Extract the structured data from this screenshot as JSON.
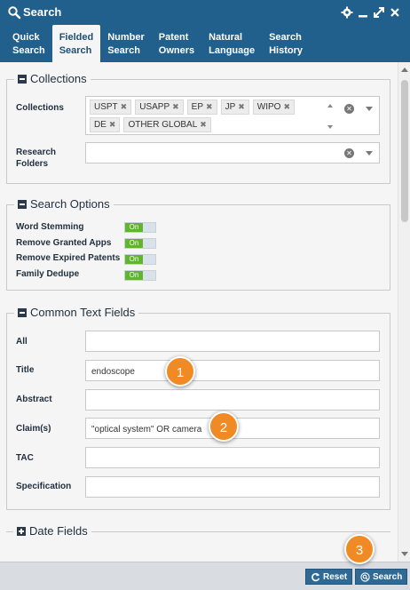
{
  "window": {
    "title": "Search"
  },
  "tabs": [
    {
      "line1": "Quick",
      "line2": "Search"
    },
    {
      "line1": "Fielded",
      "line2": "Search"
    },
    {
      "line1": "Number",
      "line2": "Search"
    },
    {
      "line1": "Patent",
      "line2": "Owners"
    },
    {
      "line1": "Natural",
      "line2": "Language"
    },
    {
      "line1": "Search",
      "line2": "History"
    }
  ],
  "collections": {
    "legend": "Collections",
    "label": "Collections",
    "chips": [
      "USPT",
      "USAPP",
      "EP",
      "JP",
      "WIPO",
      "DE",
      "OTHER GLOBAL"
    ],
    "folders_label_line1": "Research",
    "folders_label_line2": "Folders"
  },
  "options": {
    "legend": "Search Options",
    "items": [
      {
        "label": "Word Stemming",
        "state": "On"
      },
      {
        "label": "Remove Granted Apps",
        "state": "On"
      },
      {
        "label": "Remove Expired Patents",
        "state": "On"
      },
      {
        "label": "Family Dedupe",
        "state": "On"
      }
    ]
  },
  "text_fields": {
    "legend": "Common Text Fields",
    "fields": [
      {
        "label": "All",
        "value": ""
      },
      {
        "label": "Title",
        "value": "endoscope"
      },
      {
        "label": "Abstract",
        "value": ""
      },
      {
        "label": "Claim(s)",
        "value": "\"optical system\" OR camera"
      },
      {
        "label": "TAC",
        "value": ""
      },
      {
        "label": "Specification",
        "value": ""
      }
    ]
  },
  "date_fields": {
    "legend": "Date Fields"
  },
  "footer": {
    "reset_label": "Reset",
    "search_label": "Search"
  },
  "badges": [
    "1",
    "2",
    "3"
  ],
  "colors": {
    "header": "#215f8c",
    "toggle_on": "#5fb52c",
    "badge": "#f08a24",
    "button": "#2f6a95"
  }
}
